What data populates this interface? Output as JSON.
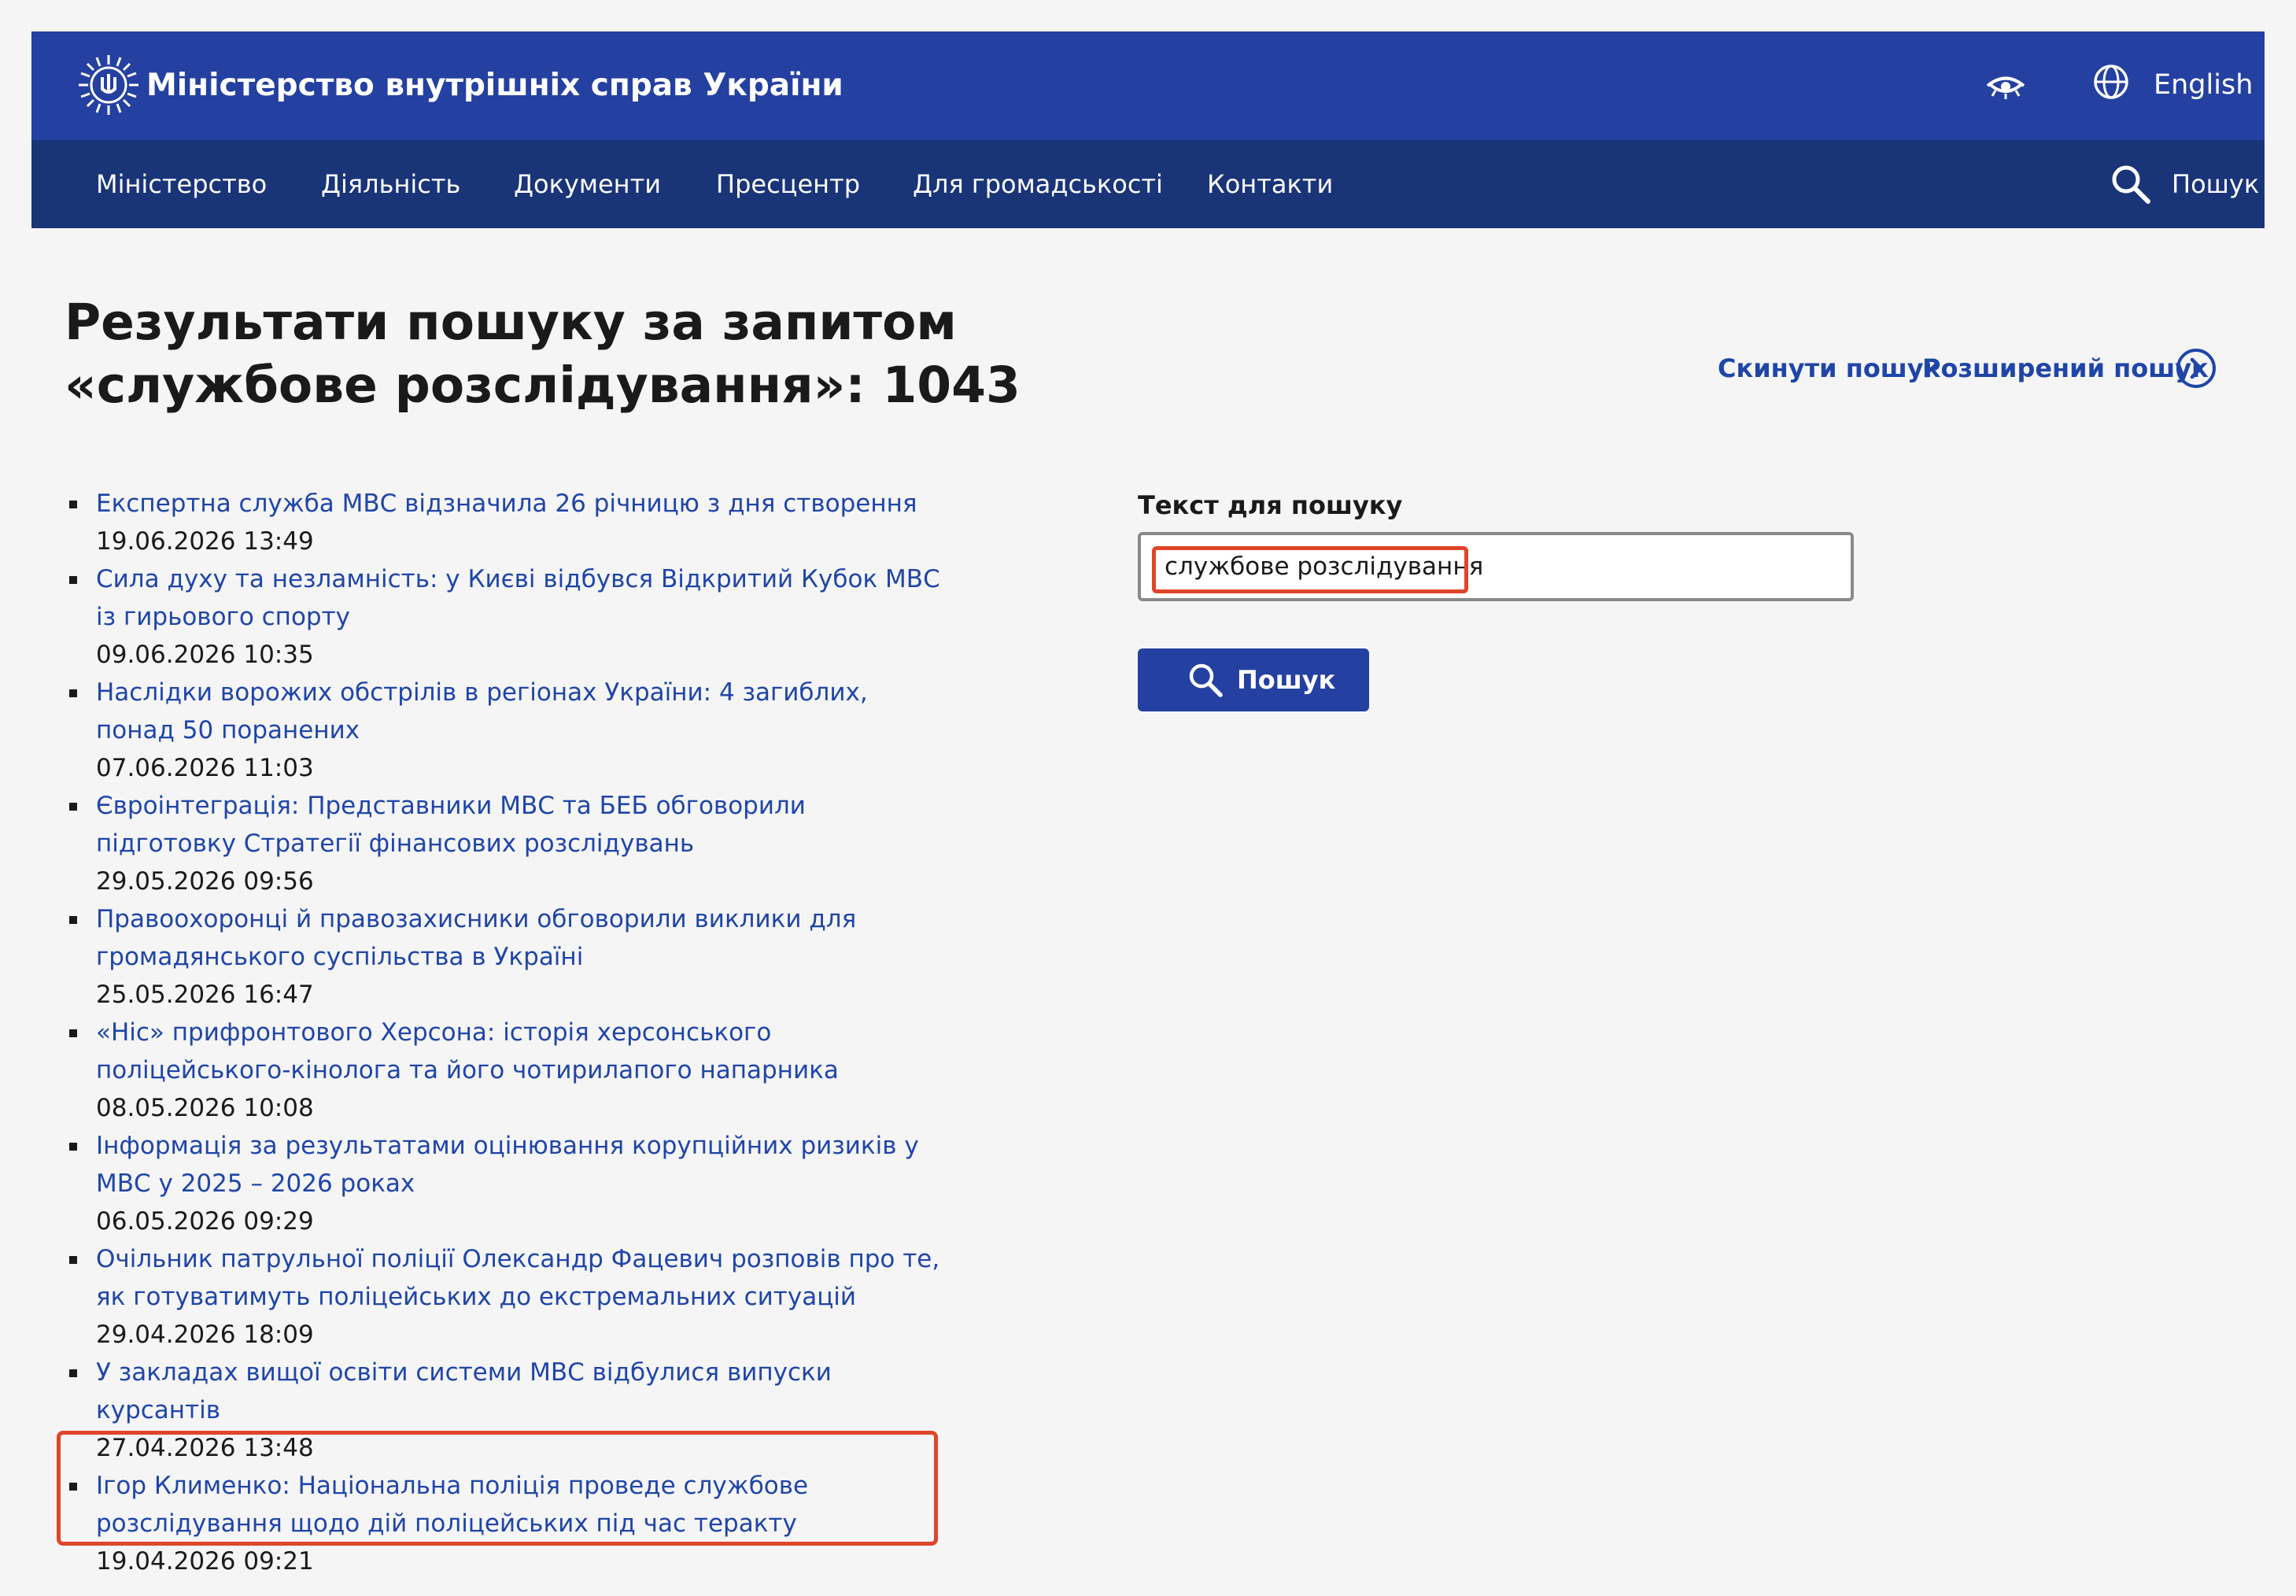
{
  "header": {
    "site_title": "Міністерство внутрішніх справ України",
    "language_link": "English",
    "icons": [
      "ministry-emblem-icon",
      "eye-icon",
      "globe-icon"
    ]
  },
  "nav": {
    "items": [
      "Міністерство",
      "Діяльність",
      "Документи",
      "Пресцентр",
      "Для громадськості",
      "Контакти"
    ],
    "search_label": "Пошук"
  },
  "page": {
    "title": "Результати пошуку за запитом «службове розслідування»: 1043",
    "reset_link": "Скинути пошук",
    "advanced_link": "Розширений пошук"
  },
  "search": {
    "label": "Текст для пошуку",
    "value": "службове розслідування",
    "button_label": "Пошук"
  },
  "results": [
    {
      "title": "Експертна служба МВС відзначила 26 річницю з дня створення",
      "date": "19.06.2026 13:49"
    },
    {
      "title": "Сила духу та незламність: у Києві відбувся Відкритий Кубок МВС із гирьового спорту",
      "date": "09.06.2026 10:35"
    },
    {
      "title": "Наслідки ворожих обстрілів в регіонах України: 4 загиблих, понад 50 поранених",
      "date": "07.06.2026 11:03"
    },
    {
      "title": "Євроінтеграція: Представники МВС та БЕБ обговорили підготовку Стратегії фінансових розслідувань",
      "date": "29.05.2026 09:56"
    },
    {
      "title": "Правоохоронці й правозахисники обговорили виклики для громадянського суспільства в Україні",
      "date": "25.05.2026 16:47"
    },
    {
      "title": "«Ніс» прифронтового Херсона: історія херсонського поліцейського-кінолога та його чотирилапого напарника",
      "date": "08.05.2026 10:08"
    },
    {
      "title": "Інформація за результатами оцінювання корупційних ризиків у МВС у 2025 – 2026 роках",
      "date": "06.05.2026 09:29"
    },
    {
      "title": "Очільник патрульної поліції Олександр Фацевич розповів про те, як готуватимуть поліцейських до екстремальних ситуацій",
      "date": "29.04.2026 18:09"
    },
    {
      "title": "У закладах вищої освіти системи МВС відбулися випуски курсантів",
      "date": "27.04.2026 13:48"
    },
    {
      "title": "Ігор Клименко: Національна поліція проведе службове розслідування щодо дій поліцейських під час теракту",
      "date": "19.04.2026 09:21"
    }
  ],
  "colors": {
    "header_bg": "#2440a0",
    "nav_bg": "#1a3478",
    "link": "#1f45a8",
    "highlight": "#e0452a",
    "page_bg": "#f5f5f5"
  }
}
